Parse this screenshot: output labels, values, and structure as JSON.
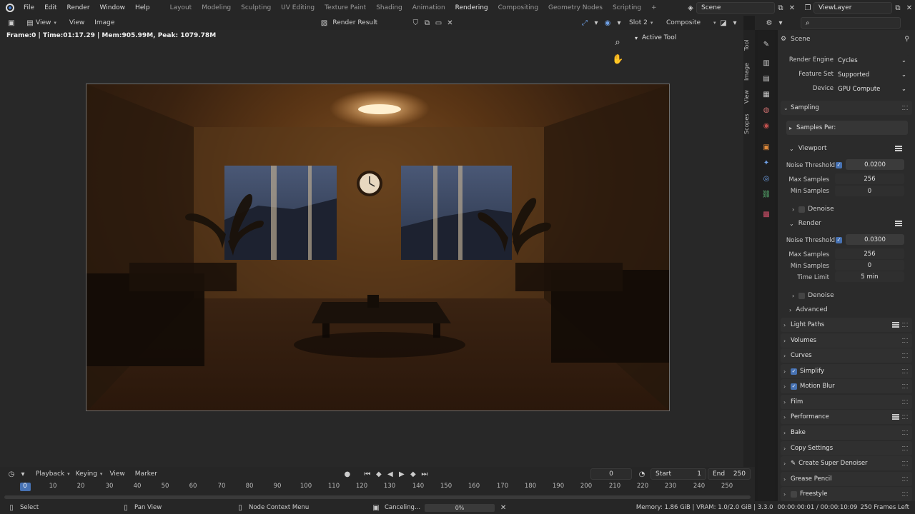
{
  "topbar": {
    "menus": [
      "File",
      "Edit",
      "Render",
      "Window",
      "Help"
    ],
    "workspaces": [
      "Layout",
      "Modeling",
      "Sculpting",
      "UV Editing",
      "Texture Paint",
      "Shading",
      "Animation",
      "Rendering",
      "Compositing",
      "Geometry Nodes",
      "Scripting"
    ],
    "active_workspace": "Rendering",
    "add_tab": "+",
    "scene": "Scene",
    "view_layer": "ViewLayer"
  },
  "image_editor": {
    "view_label": "View",
    "view_menu": "View",
    "image_menu": "Image",
    "image_name": "Render Result",
    "slot": "Slot 2",
    "layer": "Composite",
    "stats": "Frame:0 | Time:01:17.29 | Mem:905.99M, Peak: 1079.78M"
  },
  "npanel": {
    "active_tool": "Active Tool",
    "tabs": [
      "Tool",
      "Image",
      "View",
      "Scopes"
    ]
  },
  "properties": {
    "search_placeholder": "",
    "context": "Scene",
    "render_engine_label": "Render Engine",
    "render_engine": "Cycles",
    "feature_set_label": "Feature Set",
    "feature_set": "Supported",
    "device_label": "Device",
    "device": "GPU Compute",
    "sampling": "Sampling",
    "samples_per": "Samples Per:",
    "viewport": "Viewport",
    "noise_threshold_label": "Noise Threshold",
    "viewport_noise_threshold": "0.0200",
    "max_samples_label": "Max Samples",
    "viewport_max_samples": "256",
    "min_samples_label": "Min Samples",
    "viewport_min_samples": "0",
    "denoise": "Denoise",
    "render": "Render",
    "render_noise_threshold": "0.0300",
    "render_max_samples": "256",
    "render_min_samples": "0",
    "time_limit_label": "Time Limit",
    "time_limit": "5 min",
    "render_denoise": "Denoise",
    "advanced": "Advanced",
    "sections": [
      "Light Paths",
      "Volumes",
      "Curves",
      "Simplify",
      "Motion Blur",
      "Film",
      "Performance",
      "Bake",
      "Copy Settings",
      "Create Super Denoiser",
      "Grease Pencil",
      "Freestyle"
    ]
  },
  "timeline": {
    "playback": "Playback",
    "keying": "Keying",
    "view": "View",
    "marker": "Marker",
    "current_frame": "0",
    "start_label": "Start",
    "start": "1",
    "end_label": "End",
    "end": "250",
    "ruler": [
      "0",
      "10",
      "20",
      "30",
      "40",
      "50",
      "60",
      "70",
      "80",
      "90",
      "100",
      "110",
      "120",
      "130",
      "140",
      "150",
      "160",
      "170",
      "180",
      "190",
      "200",
      "210",
      "220",
      "230",
      "240",
      "250"
    ]
  },
  "statusbar": {
    "select": "Select",
    "pan_view": "Pan View",
    "node_context_menu": "Node Context Menu",
    "canceling": "Canceling...",
    "progress": "0%",
    "memory": "Memory: 1.86 GiB | VRAM: 1.0/2.0 GiB | 3.3.0",
    "time": "00:00:00:01 / 00:00:10:09",
    "frames_left": "250 Frames Left"
  },
  "colors": {
    "accent": "#4772b3",
    "panel_bg": "#2b2b2b",
    "header_bg": "#262626"
  }
}
